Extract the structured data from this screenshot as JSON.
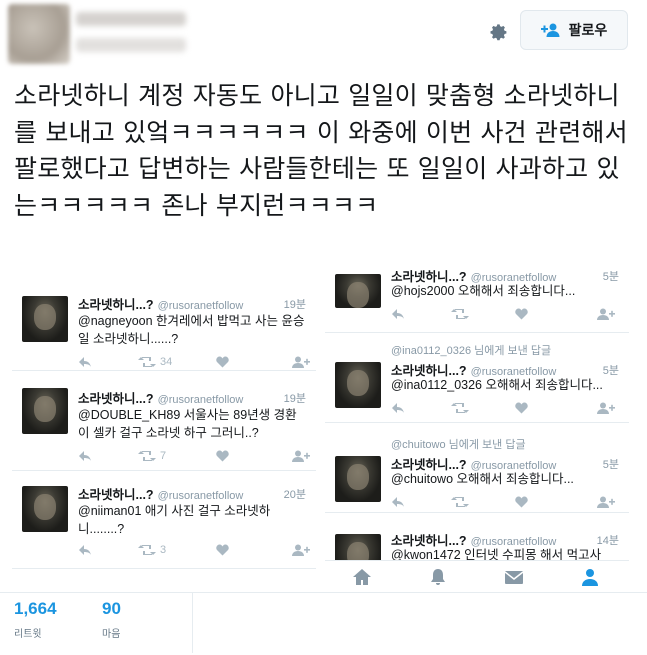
{
  "header": {
    "follow_label": "팔로우"
  },
  "tweet": {
    "text": "소라넷하니 계정 자동도 아니고 일일이 맞춤형 소라넷하니를 보내고 있엌ㅋㅋㅋㅋㅋㅋ 이 와중에 이번 사건 관련해서 팔로했다고 답변하는 사람들한테는 또 일일이 사과하고 있는ㅋㅋㅋㅋㅋ 존나 부지런ㅋㅋㅋㅋ"
  },
  "left_shot": {
    "tweets": [
      {
        "name": "소라넷하니...?",
        "handle": "@rusoranetfollow",
        "time": "19분",
        "body": "@nagneyoon 한겨레에서 밥먹고 사는 윤승일 소라넷하니......?",
        "retweets": "34"
      },
      {
        "name": "소라넷하니...?",
        "handle": "@rusoranetfollow",
        "time": "19분",
        "body": "@DOUBLE_KH89 서울사는 89년생 경환이 셀카 걸구 소라넷 하구 그러니..?",
        "retweets": "7"
      },
      {
        "name": "소라넷하니...?",
        "handle": "@rusoranetfollow",
        "time": "20분",
        "body": "@niiman01 애기 사진 걸구 소라넷하니........?",
        "retweets": "3"
      }
    ]
  },
  "right_shot": {
    "tweets": [
      {
        "replied": "",
        "name": "소라넷하니...?",
        "handle": "@rusoranetfollow",
        "time": "5분",
        "body": "@hojs2000 오해해서 죄송합니다..."
      },
      {
        "replied": "@ina0112_0326 님에게 보낸 답글",
        "name": "소라넷하니...?",
        "handle": "@rusoranetfollow",
        "time": "5분",
        "body": "@ina0112_0326 오해해서 죄송합니다..."
      },
      {
        "replied": "@chuitowo 님에게 보낸 답글",
        "name": "소라넷하니...?",
        "handle": "@rusoranetfollow",
        "time": "5분",
        "body": "@chuitowo 오해해서 죄송합니다..."
      },
      {
        "replied": "",
        "name": "소라넷하니...?",
        "handle": "@rusoranetfollow",
        "time": "14분",
        "body": "@kwon1472 인터넷 수피몽 해서 먹고사"
      }
    ]
  },
  "stats": {
    "retweets_count": "1,664",
    "retweets_label": "리트윗",
    "likes_count": "90",
    "likes_label": "마음"
  },
  "colors": {
    "accent": "#1b95e0",
    "muted": "#8899a6",
    "text": "#14171a"
  },
  "icons": [
    "gear-icon",
    "follow-person-icon",
    "reply-icon",
    "retweet-icon",
    "heart-icon",
    "follow-user-icon",
    "home-icon",
    "notifications-icon",
    "messages-icon",
    "profile-icon"
  ]
}
